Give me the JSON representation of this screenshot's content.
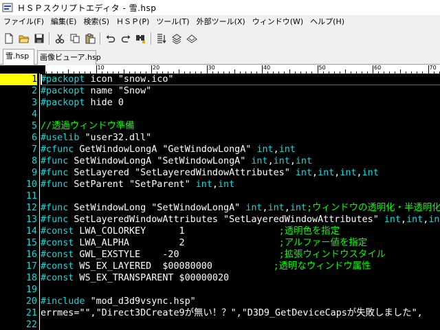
{
  "window": {
    "title": "ＨＳＰスクリプトエディタ - 雪.hsp"
  },
  "menu": [
    "ファイル(F)",
    "編集(E)",
    "検索(S)",
    "ＨＳＰ(P)",
    "ツール(T)",
    "外部ツール(X)",
    "ウィンドウ(W)",
    "ヘルプ(H)"
  ],
  "toolbar": {
    "buttons": [
      "new-file-icon",
      "open-folder-icon",
      "save-icon",
      "cut-icon",
      "copy-icon",
      "paste-icon",
      "undo-icon",
      "redo-icon",
      "find-icon",
      "run-list-icon",
      "compile-icon",
      "help-icon"
    ]
  },
  "tabs": [
    {
      "label": "雪.hsp",
      "active": true
    },
    {
      "label": "画像ビューア.hsp",
      "active": false
    }
  ],
  "ruler": {
    "labels": [
      "0",
      "10",
      "20",
      "30",
      "40",
      "50",
      "60",
      "70"
    ]
  },
  "editor": {
    "current_line": 1,
    "colors": {
      "background": "#000000",
      "line_number": "#00e0e0",
      "current_line_number_bg": "#ffff00",
      "comment": "#00ff00",
      "keyword": "#00e0e0",
      "text": "#ffffff",
      "cursor_line": "#ff3030"
    },
    "lines": [
      {
        "n": "1",
        "tokens": [
          [
            "d",
            "#packopt"
          ],
          [
            "t",
            " icon "
          ],
          [
            "s",
            "\"snow.ico\""
          ]
        ]
      },
      {
        "n": "2",
        "tokens": [
          [
            "d",
            "#packopt"
          ],
          [
            "t",
            " name "
          ],
          [
            "s",
            "\"Snow\""
          ]
        ]
      },
      {
        "n": "3",
        "tokens": [
          [
            "d",
            "#packopt"
          ],
          [
            "t",
            " hide 0"
          ]
        ]
      },
      {
        "n": "4",
        "tokens": []
      },
      {
        "n": "5",
        "tokens": [
          [
            "c",
            "//透過ウィンドウ準備"
          ]
        ]
      },
      {
        "n": "6",
        "tokens": [
          [
            "d",
            "#uselib"
          ],
          [
            "t",
            " "
          ],
          [
            "s",
            "\"user32.dll\""
          ]
        ]
      },
      {
        "n": "7",
        "tokens": [
          [
            "d",
            "#cfunc"
          ],
          [
            "t",
            " GetWindowLongA "
          ],
          [
            "s",
            "\"GetWindowLongA\""
          ],
          [
            "t",
            " "
          ],
          [
            "k",
            "int"
          ],
          [
            "t",
            ","
          ],
          [
            "k",
            "int"
          ]
        ]
      },
      {
        "n": "8",
        "tokens": [
          [
            "d",
            "#func"
          ],
          [
            "t",
            " SetWindowLongA "
          ],
          [
            "s",
            "\"SetWindowLongA\""
          ],
          [
            "t",
            " "
          ],
          [
            "k",
            "int"
          ],
          [
            "t",
            ","
          ],
          [
            "k",
            "int"
          ],
          [
            "t",
            ","
          ],
          [
            "k",
            "int"
          ]
        ]
      },
      {
        "n": "9",
        "tokens": [
          [
            "d",
            "#func"
          ],
          [
            "t",
            " SetLayered "
          ],
          [
            "s",
            "\"SetLayeredWindowAttributes\""
          ],
          [
            "t",
            " "
          ],
          [
            "k",
            "int"
          ],
          [
            "t",
            ","
          ],
          [
            "k",
            "int"
          ],
          [
            "t",
            ","
          ],
          [
            "k",
            "int"
          ],
          [
            "t",
            ","
          ],
          [
            "k",
            "int"
          ]
        ]
      },
      {
        "n": "10",
        "tokens": [
          [
            "d",
            "#func"
          ],
          [
            "t",
            " SetParent "
          ],
          [
            "s",
            "\"SetParent\""
          ],
          [
            "t",
            " "
          ],
          [
            "k",
            "int"
          ],
          [
            "t",
            ","
          ],
          [
            "k",
            "int"
          ]
        ]
      },
      {
        "n": "11",
        "tokens": []
      },
      {
        "n": "12",
        "tokens": [
          [
            "d",
            "#func"
          ],
          [
            "t",
            " SetWindowLong "
          ],
          [
            "s",
            "\"SetWindowLongA\""
          ],
          [
            "t",
            " "
          ],
          [
            "k",
            "int"
          ],
          [
            "t",
            ","
          ],
          [
            "k",
            "int"
          ],
          [
            "t",
            ","
          ],
          [
            "k",
            "int"
          ],
          [
            "c",
            ";ウィンドウの透明化・半透明化"
          ]
        ]
      },
      {
        "n": "13",
        "tokens": [
          [
            "d",
            "#func"
          ],
          [
            "t",
            " SetLayeredWindowAttributes "
          ],
          [
            "s",
            "\"SetLayeredWindowAttributes\""
          ],
          [
            "t",
            " "
          ],
          [
            "k",
            "int"
          ],
          [
            "t",
            ","
          ],
          [
            "k",
            "int"
          ],
          [
            "t",
            ","
          ],
          [
            "k",
            "int"
          ],
          [
            "t",
            ","
          ],
          [
            "k",
            "int"
          ]
        ]
      },
      {
        "n": "14",
        "tokens": [
          [
            "d",
            "#const"
          ],
          [
            "t",
            " LWA_COLORKEY      1                 "
          ],
          [
            "c",
            ";透明色を指定"
          ]
        ]
      },
      {
        "n": "15",
        "tokens": [
          [
            "d",
            "#const"
          ],
          [
            "t",
            " LWA_ALPHA         2                 "
          ],
          [
            "c",
            ";アルファー値を指定"
          ]
        ]
      },
      {
        "n": "16",
        "tokens": [
          [
            "d",
            "#const"
          ],
          [
            "t",
            " GWL_EXSTYLE    -20                  "
          ],
          [
            "c",
            ";拡張ウィンドウスタイル"
          ]
        ]
      },
      {
        "n": "17",
        "tokens": [
          [
            "d",
            "#const"
          ],
          [
            "t",
            " WS_EX_LAYERED  $00080000           "
          ],
          [
            "c",
            ";透明なウィンドウ属性"
          ]
        ]
      },
      {
        "n": "18",
        "tokens": [
          [
            "d",
            "#const"
          ],
          [
            "t",
            " WS_EX_TRANSPARENT $00000020"
          ]
        ]
      },
      {
        "n": "19",
        "tokens": []
      },
      {
        "n": "20",
        "tokens": [
          [
            "d",
            "#include"
          ],
          [
            "t",
            " "
          ],
          [
            "s",
            "\"mod_d3d9vsync.hsp\""
          ]
        ]
      },
      {
        "n": "21",
        "tokens": [
          [
            "t",
            "errmes="
          ],
          [
            "s",
            "\"\",\"Direct3DCreate9が無い！？\",\"D3D9_GetDeviceCapsが失敗しました\","
          ]
        ]
      },
      {
        "n": "22",
        "tokens": []
      }
    ]
  }
}
